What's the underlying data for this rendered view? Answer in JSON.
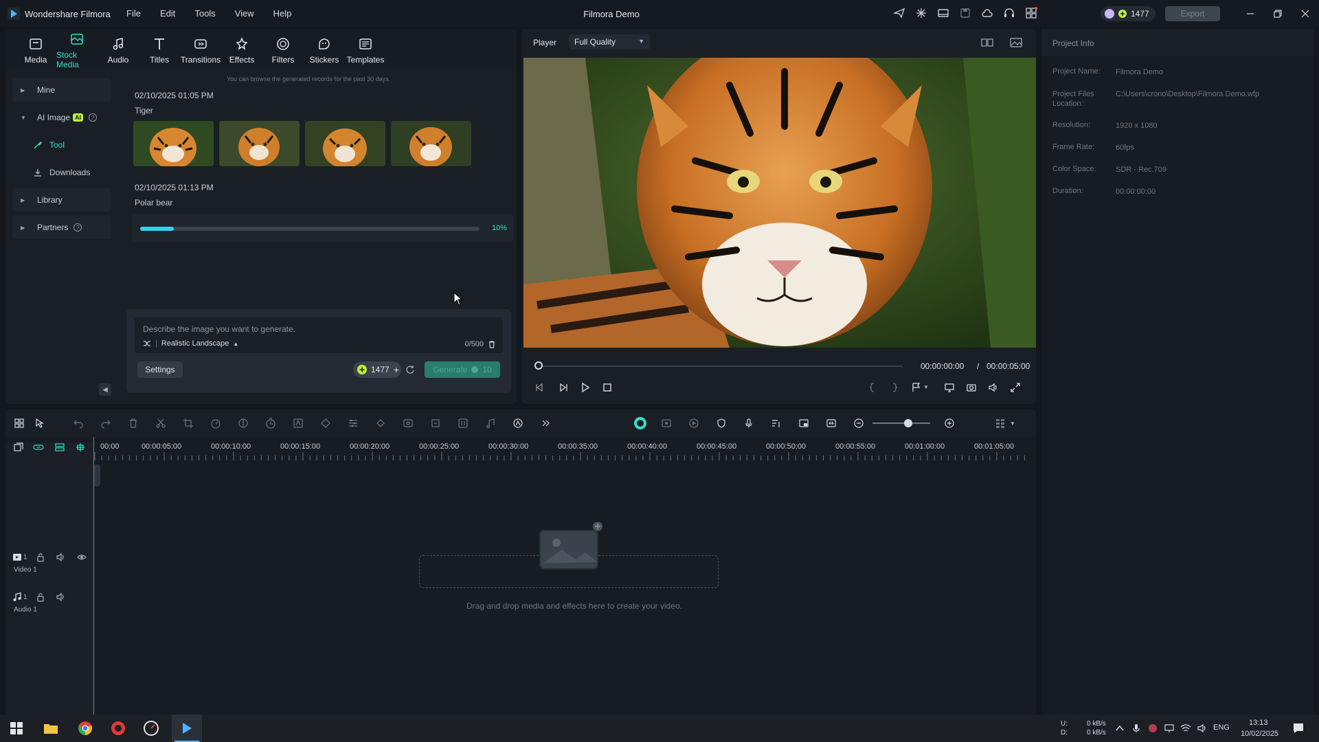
{
  "titlebar": {
    "app_name": "Wondershare Filmora",
    "menu": [
      "File",
      "Edit",
      "Tools",
      "View",
      "Help"
    ],
    "project_title": "Filmora Demo",
    "credits": "1477",
    "export_label": "Export"
  },
  "toolbar": {
    "tabs": [
      {
        "label": "Media",
        "icon": "media-icon"
      },
      {
        "label": "Stock Media",
        "icon": "stock-media-icon",
        "active": true
      },
      {
        "label": "Audio",
        "icon": "audio-icon"
      },
      {
        "label": "Titles",
        "icon": "titles-icon"
      },
      {
        "label": "Transitions",
        "icon": "transitions-icon"
      },
      {
        "label": "Effects",
        "icon": "effects-icon"
      },
      {
        "label": "Filters",
        "icon": "filters-icon"
      },
      {
        "label": "Stickers",
        "icon": "stickers-icon"
      },
      {
        "label": "Templates",
        "icon": "templates-icon"
      }
    ]
  },
  "sidenav": {
    "mine": "Mine",
    "ai_image": "AI Image",
    "ai_badge": "AI",
    "tool": "Tool",
    "downloads": "Downloads",
    "library": "Library",
    "partners": "Partners"
  },
  "records": {
    "note": "You can browse the generated records for the past 30 days.",
    "items": [
      {
        "date": "02/10/2025 01:05 PM",
        "title": "Tiger"
      },
      {
        "date": "02/10/2025 01:13 PM",
        "title": "Polar bear",
        "progress": 0.1,
        "progress_label": "10%"
      }
    ]
  },
  "prompt": {
    "placeholder": "Describe the image you want to generate.",
    "style": "Realistic Landscape",
    "counter": "0/500",
    "settings_label": "Settings",
    "credits": "1477",
    "generate_label": "Generate",
    "generate_cost": "10"
  },
  "player": {
    "label": "Player",
    "quality": "Full Quality",
    "current_time": "00:00:00:00",
    "separator": "/",
    "total_time": "00:00:05:00"
  },
  "project_info": {
    "title": "Project Info",
    "rows": [
      {
        "key": "Project Name:",
        "value": "Filmora Demo"
      },
      {
        "key": "Project Files Location:",
        "value": "C:\\Users\\crono\\Desktop\\Filmora Demo.wfp"
      },
      {
        "key": "Resolution:",
        "value": "1920 x 1080"
      },
      {
        "key": "Frame Rate:",
        "value": "60fps"
      },
      {
        "key": "Color Space:",
        "value": "SDR - Rec.709"
      },
      {
        "key": "Duration:",
        "value": "00:00:00:00"
      }
    ]
  },
  "timeline": {
    "ruler": [
      "00:00",
      "00:00:05:00",
      "00:00:10:00",
      "00:00:15:00",
      "00:00:20:00",
      "00:00:25:00",
      "00:00:30:00",
      "00:00:35:00",
      "00:00:40:00",
      "00:00:45:00",
      "00:00:50:00",
      "00:00:55:00",
      "00:01:00:00",
      "00:01:05:00"
    ],
    "video_track": "Video 1",
    "video_track_num": "1",
    "audio_track": "Audio 1",
    "audio_track_num": "1",
    "drop_hint": "Drag and drop media and effects here to create your video."
  },
  "taskbar": {
    "net_up_label": "U:",
    "net_down_label": "D:",
    "net_up": "0 kB/s",
    "net_down": "0 kB/s",
    "lang": "ENG",
    "time": "13:13",
    "date": "10/02/2025"
  },
  "colors": {
    "accent": "#35e0c6",
    "progress": "#35d3ea",
    "ai_badge": "#b9ef3a"
  }
}
